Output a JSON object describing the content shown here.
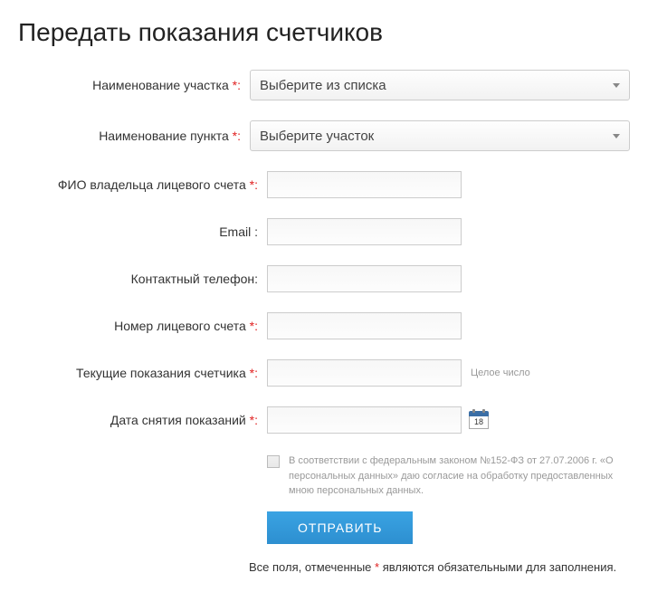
{
  "title": "Передать показания счетчиков",
  "fields": {
    "district": {
      "label": "Наименование участка",
      "required_mark": "*:",
      "value": "Выберите из списка"
    },
    "point": {
      "label": "Наименование пункта",
      "required_mark": "*:",
      "value": "Выберите участок"
    },
    "owner": {
      "label": "ФИО владельца лицевого счета",
      "required_mark": "*:"
    },
    "email": {
      "label": "Email :"
    },
    "phone": {
      "label": "Контактный телефон:"
    },
    "account": {
      "label": "Номер лицевого счета",
      "required_mark": "*:"
    },
    "reading": {
      "label": "Текущие показания счетчика",
      "required_mark": "*:",
      "hint": "Целое число"
    },
    "reading_date": {
      "label": "Дата снятия показаний",
      "required_mark": "*:",
      "calendar_day": "18"
    }
  },
  "consent_text": "В соответствии с федеральным законом №152-ФЗ от 27.07.2006 г. «О персональных данных» даю согласие на обработку предоставленных мною персональных данных.",
  "submit_label": "ОТПРАВИТЬ",
  "footnote_before": "Все поля, отмеченные ",
  "footnote_mark": "*",
  "footnote_after": " являются обязательными для заполнения."
}
